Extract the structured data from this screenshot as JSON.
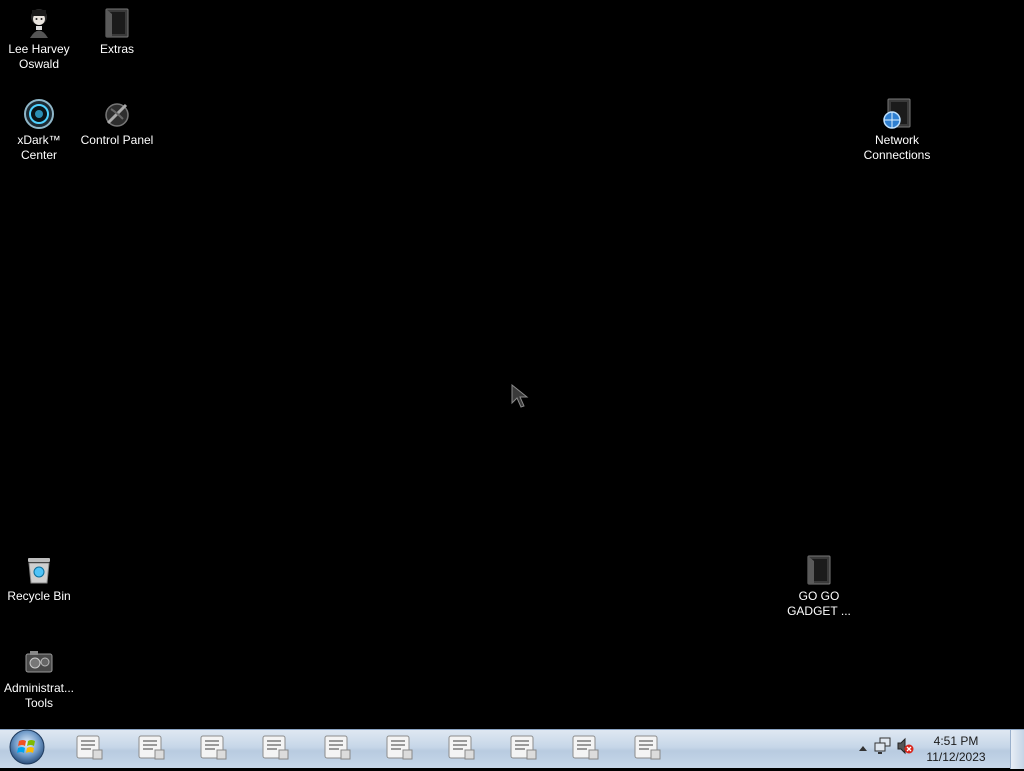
{
  "desktop": {
    "icons": [
      {
        "label": "Lee Harvey\nOswald",
        "icon": "user-avatar-icon"
      },
      {
        "label": "Extras",
        "icon": "dark-folder-icon"
      },
      {
        "label": "xDark™\nCenter",
        "icon": "xdark-center-icon"
      },
      {
        "label": "Control Panel",
        "icon": "control-panel-icon"
      },
      {
        "label": "Network\nConnections",
        "icon": "network-folder-icon"
      },
      {
        "label": "Recycle Bin",
        "icon": "recycle-bin-icon"
      },
      {
        "label": "GO GO\nGADGET ...",
        "icon": "dark-folder-icon"
      },
      {
        "label": "Administrat...\nTools",
        "icon": "admin-tools-icon"
      }
    ]
  },
  "taskbar": {
    "start_icon": "windows-start-orb-icon",
    "buttons": [
      {
        "icon": "document-app-icon"
      },
      {
        "icon": "document-app-icon"
      },
      {
        "icon": "document-app-icon"
      },
      {
        "icon": "document-app-icon"
      },
      {
        "icon": "document-app-icon"
      },
      {
        "icon": "document-app-icon"
      },
      {
        "icon": "document-app-icon"
      },
      {
        "icon": "document-app-icon"
      },
      {
        "icon": "document-app-icon"
      },
      {
        "icon": "document-app-icon"
      }
    ],
    "tray": {
      "show_hidden_icon": "chevron-up-icon",
      "network_icon": "network-icon",
      "volume_icon": "volume-muted-icon",
      "time": "4:51 PM",
      "date": "11/12/2023"
    }
  }
}
